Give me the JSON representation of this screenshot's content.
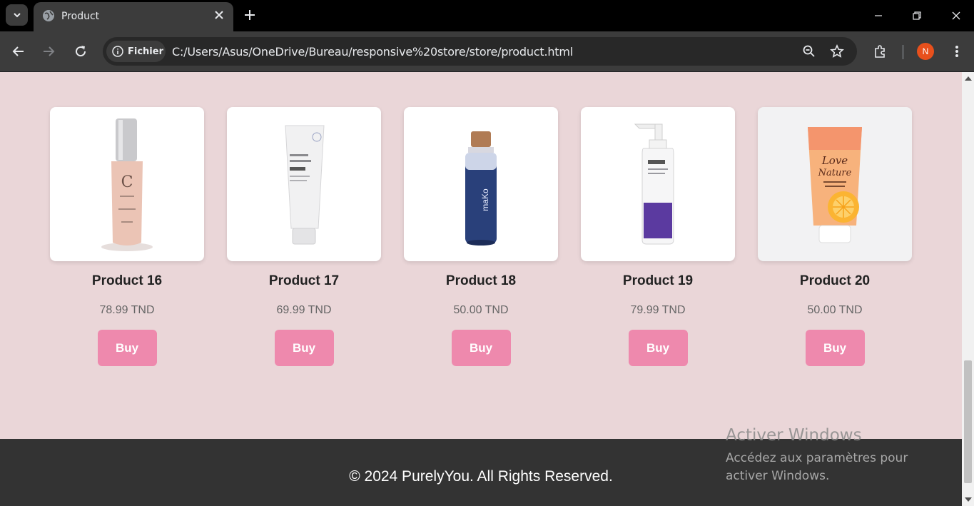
{
  "browser": {
    "tab_title": "Product",
    "site_chip_label": "Fichier",
    "url": "C:/Users/Asus/OneDrive/Bureau/responsive%20store/store/product.html",
    "profile_initial": "N"
  },
  "products": [
    {
      "name": "Product 16",
      "price": "78.99 TND",
      "buy_label": "Buy",
      "image": "foundation-bottle-icon"
    },
    {
      "name": "Product 17",
      "price": "69.99 TND",
      "buy_label": "Buy",
      "image": "cream-tube-icon"
    },
    {
      "name": "Product 18",
      "price": "50.00 TND",
      "buy_label": "Buy",
      "image": "blue-bottle-icon"
    },
    {
      "name": "Product 19",
      "price": "79.99 TND",
      "buy_label": "Buy",
      "image": "pump-bottle-icon"
    },
    {
      "name": "Product 20",
      "price": "50.00 TND",
      "buy_label": "Buy",
      "image": "face-gel-tube-icon"
    }
  ],
  "footer": {
    "text": "© 2024 PurelyYou. All Rights Reserved."
  },
  "watermark": {
    "title": "Activer Windows",
    "subtitle": "Accédez aux paramètres pour activer Windows."
  },
  "colors": {
    "page_bg": "#ead6d8",
    "buy_button": "#ee89ad",
    "footer_bg": "#333333"
  }
}
